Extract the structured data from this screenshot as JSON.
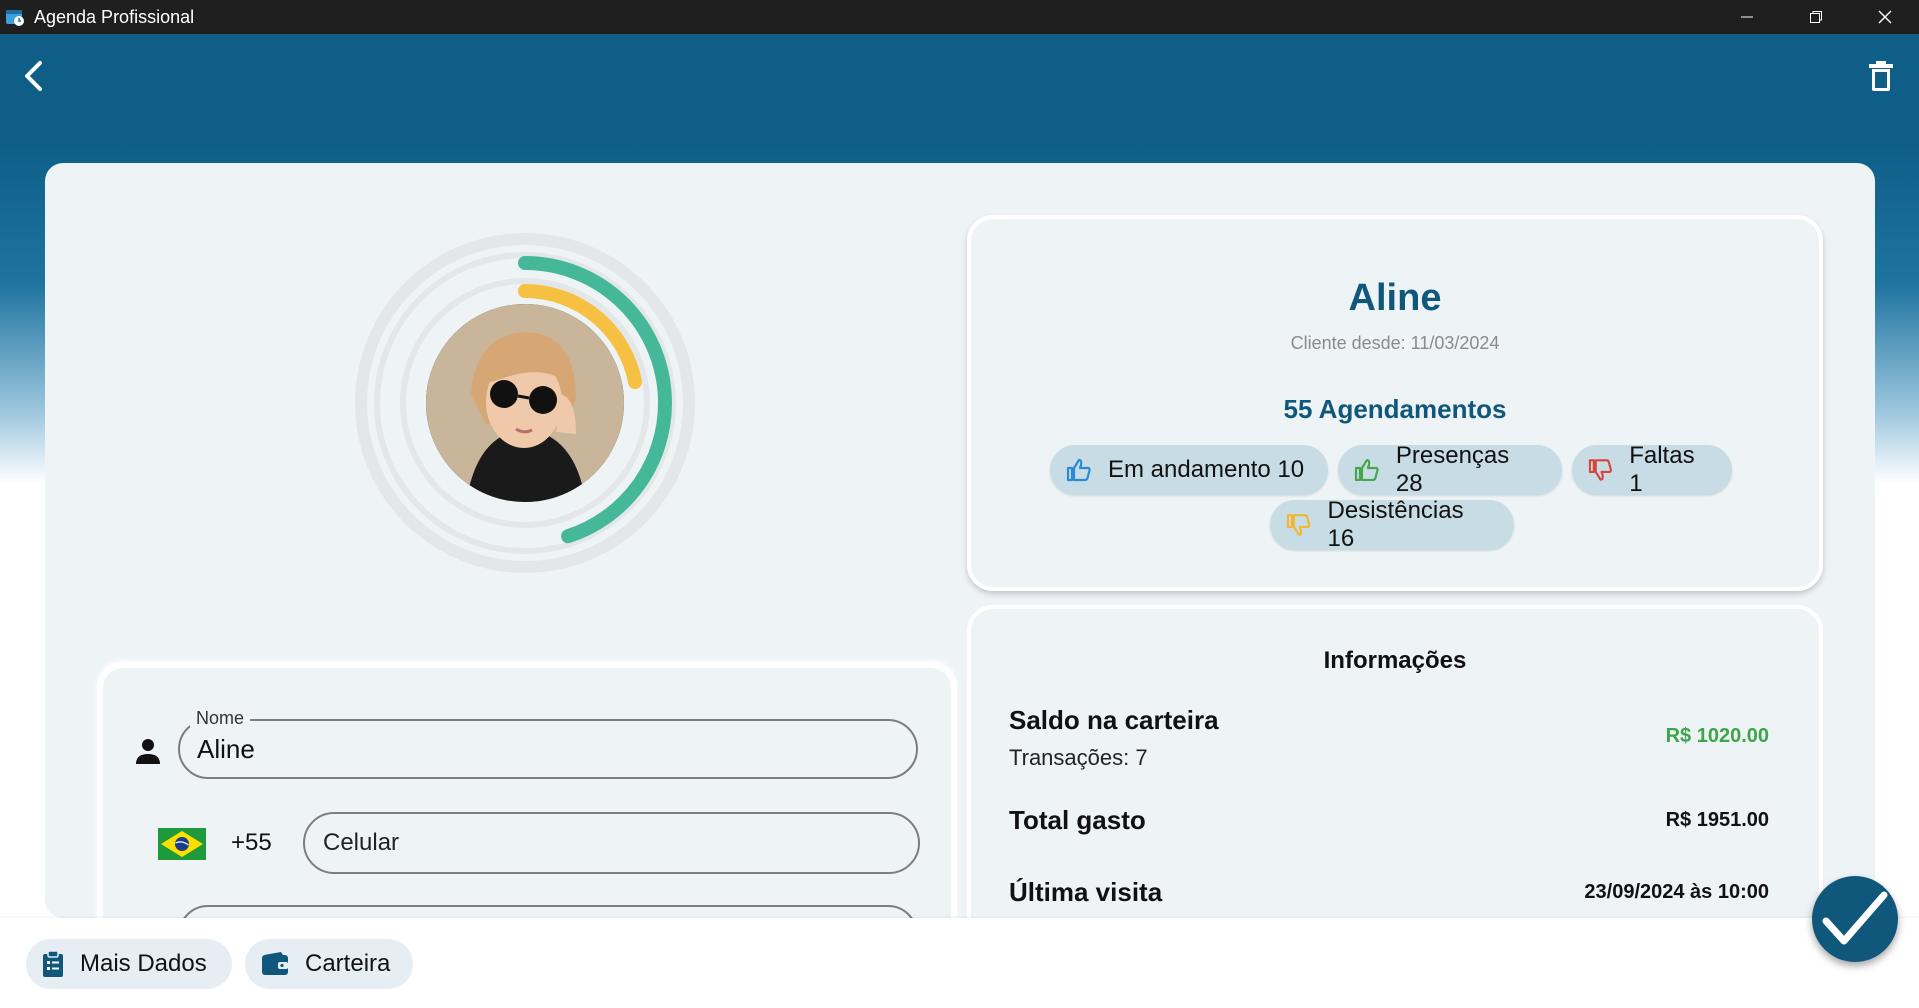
{
  "window": {
    "title": "Agenda Profissional"
  },
  "profile": {
    "name": "Aline",
    "client_since": "Cliente desde: 11/03/2024",
    "appointments_summary": "55 Agendamentos",
    "ring_progress": {
      "outer": 0.45,
      "inner": 0.22
    },
    "ring_colors": {
      "outer": "#45b89a",
      "inner": "#f6c142"
    },
    "chips": [
      {
        "label": "Em andamento 10",
        "icon": "thumbs-up-icon",
        "color": "#2b8ad6"
      },
      {
        "label": "Presenças 28",
        "icon": "thumbs-up-icon",
        "color": "#47a64a"
      },
      {
        "label": "Faltas 1",
        "icon": "thumbs-down-icon",
        "color": "#d9453c"
      },
      {
        "label": "Desistências 16",
        "icon": "thumbs-down-icon",
        "color": "#f2b731"
      }
    ]
  },
  "form": {
    "name_label": "Nome",
    "name_value": "Aline",
    "country_code": "+55",
    "phone_placeholder": "Celular"
  },
  "info": {
    "title": "Informações",
    "wallet_label": "Saldo na carteira",
    "transactions": "Transações: 7",
    "wallet_value": "R$ 1020.00",
    "wallet_value_color": "#3fa54a",
    "total_label": "Total gasto",
    "total_value": "R$ 1951.00",
    "last_visit_label": "Última visita",
    "last_visit_value": "23/09/2024 às 10:00"
  },
  "bottom": {
    "more_data": "Mais Dados",
    "wallet": "Carteira"
  },
  "colors": {
    "primary": "#10577c",
    "header": "#0e5e87"
  }
}
